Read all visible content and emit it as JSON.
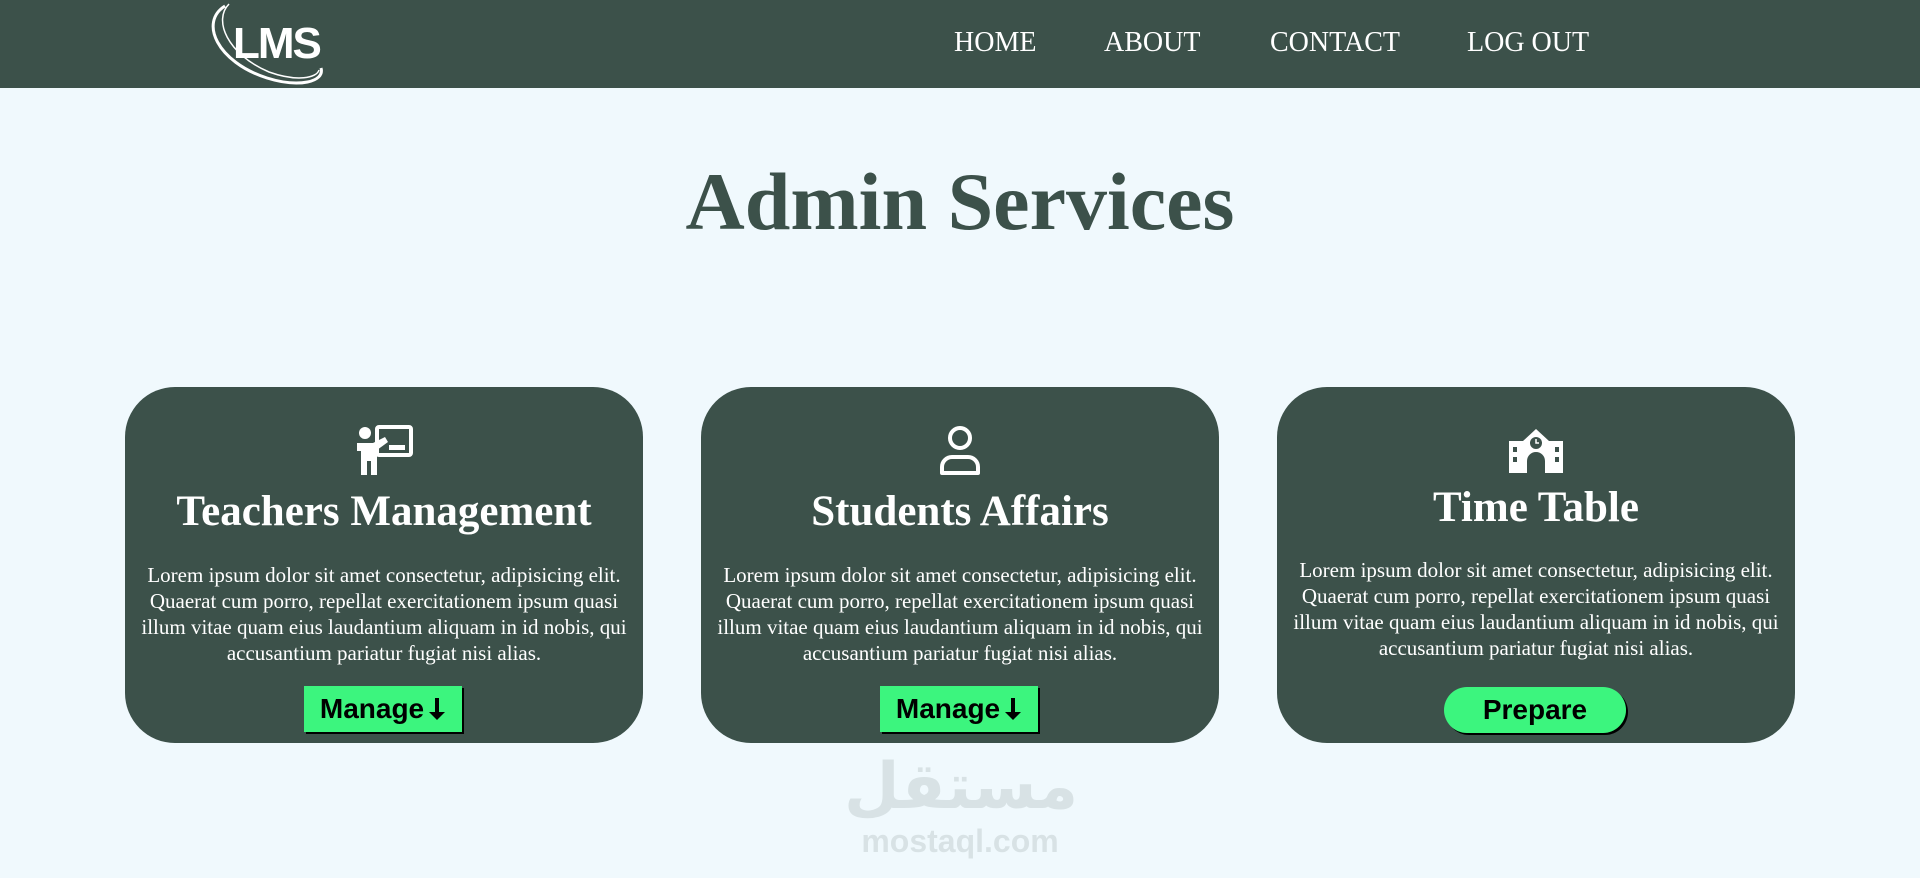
{
  "header": {
    "logo_text": "LMS",
    "nav": [
      {
        "label": "HOME"
      },
      {
        "label": "ABOUT"
      },
      {
        "label": "CONTACT"
      },
      {
        "label": "LOG OUT"
      }
    ]
  },
  "main": {
    "title": "Admin Services",
    "cards": [
      {
        "icon": "teacher-board-icon",
        "title": "Teachers Management",
        "text": "Lorem ipsum dolor sit amet consectetur, adipisicing elit. Quaerat cum porro, repellat exercitationem ipsum quasi illum vitae quam eius laudantium aliquam in id nobis, qui accusantium pariatur fugiat nisi alias.",
        "button": "Manage",
        "button_icon": "arrow-down-icon"
      },
      {
        "icon": "user-icon",
        "title": "Students Affairs",
        "text": "Lorem ipsum dolor sit amet consectetur, adipisicing elit. Quaerat cum porro, repellat exercitationem ipsum quasi illum vitae quam eius laudantium aliquam in id nobis, qui accusantium pariatur fugiat nisi alias.",
        "button": "Manage",
        "button_icon": "arrow-down-icon"
      },
      {
        "icon": "school-icon",
        "title": "Time Table",
        "text": "Lorem ipsum dolor sit amet consectetur, adipisicing elit. Quaerat cum porro, repellat exercitationem ipsum quasi illum vitae quam eius laudantium aliquam in id nobis, qui accusantium pariatur fugiat nisi alias.",
        "button": "Prepare"
      }
    ]
  },
  "watermark": {
    "arabic": "مستقل",
    "latin": "mostaql.com"
  },
  "colors": {
    "primary": "#3c514a",
    "background": "#f0f9fd",
    "button": "#3cf57e",
    "text_light": "#ffffff"
  }
}
